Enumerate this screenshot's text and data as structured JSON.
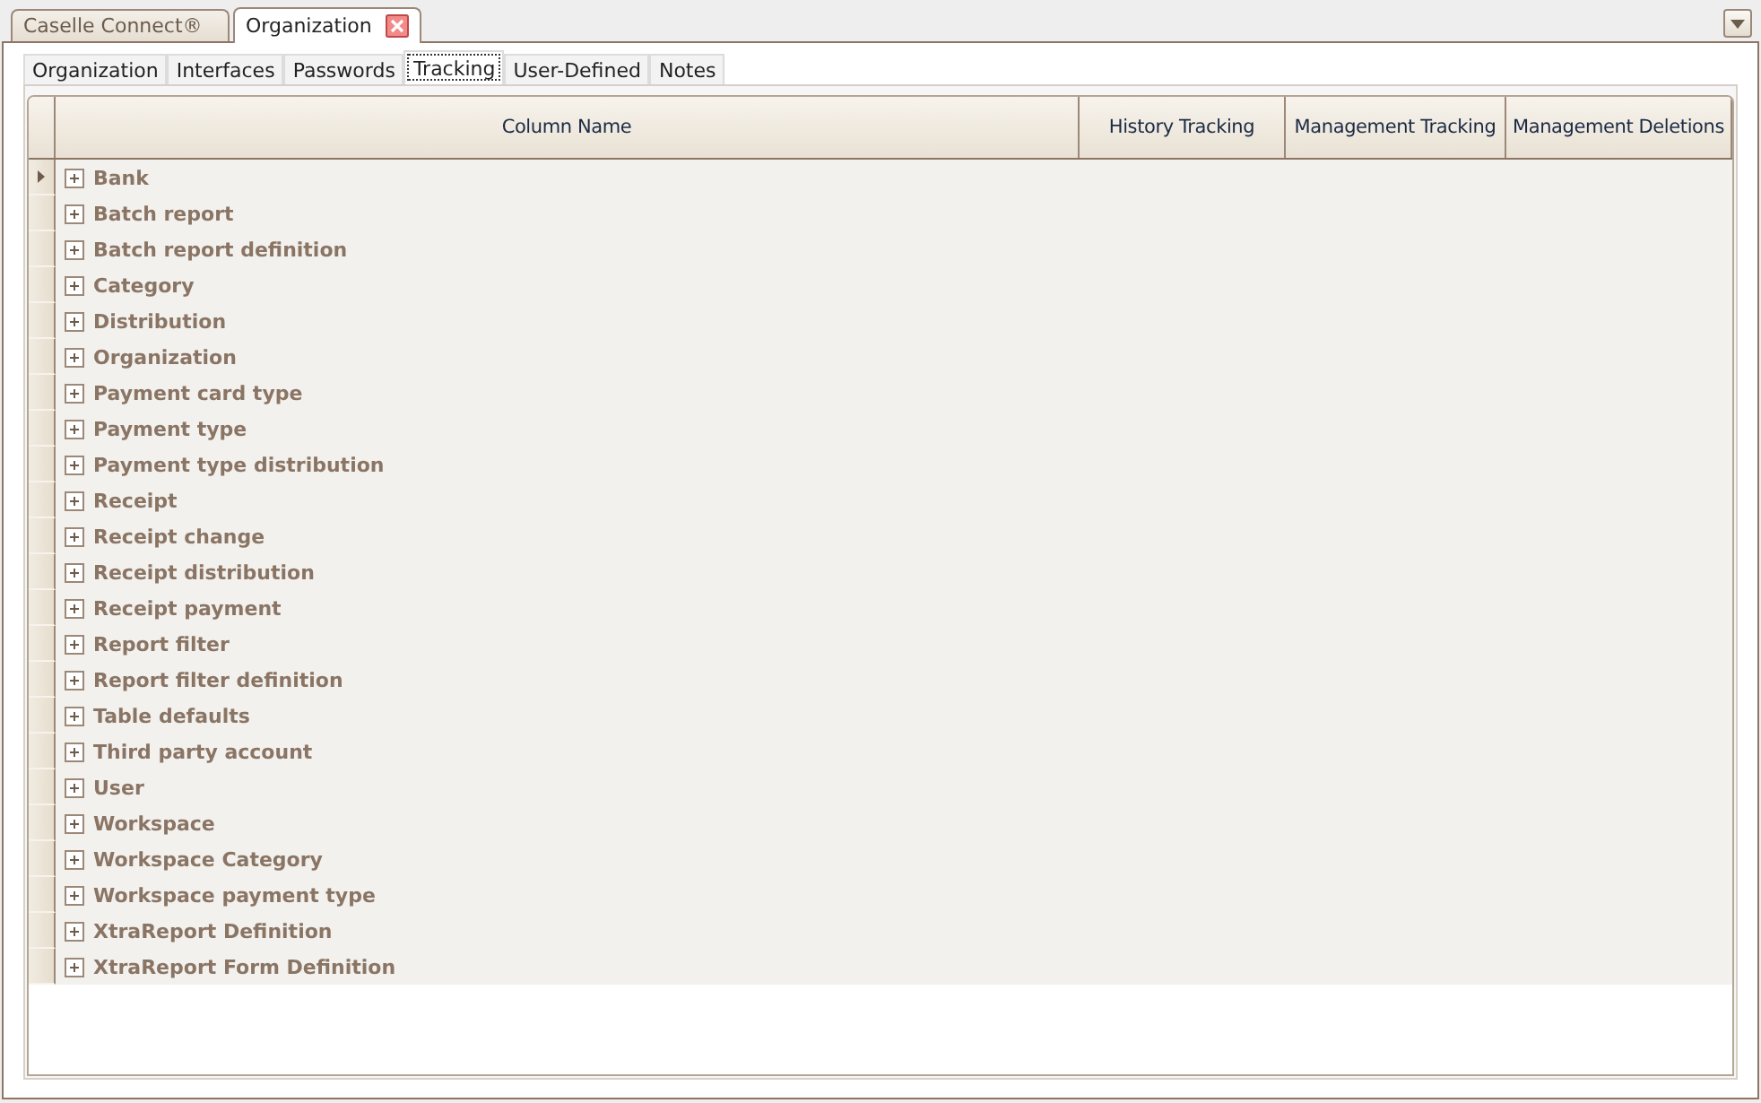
{
  "document_tabs": [
    {
      "label": "Caselle Connect®",
      "selected": false,
      "closable": false
    },
    {
      "label": "Organization",
      "selected": true,
      "closable": true
    }
  ],
  "tabs": [
    {
      "label": "Organization",
      "selected": false
    },
    {
      "label": "Interfaces",
      "selected": false
    },
    {
      "label": "Passwords",
      "selected": false
    },
    {
      "label": "Tracking",
      "selected": true
    },
    {
      "label": "User-Defined",
      "selected": false
    },
    {
      "label": "Notes",
      "selected": false
    }
  ],
  "table": {
    "columns": [
      "Column Name",
      "History Tracking",
      "Management Tracking",
      "Management Deletions"
    ],
    "rows": [
      {
        "name": "Bank",
        "selected": true,
        "expanded": false
      },
      {
        "name": "Batch report",
        "selected": false,
        "expanded": false
      },
      {
        "name": "Batch report definition",
        "selected": false,
        "expanded": false
      },
      {
        "name": "Category",
        "selected": false,
        "expanded": false
      },
      {
        "name": "Distribution",
        "selected": false,
        "expanded": false
      },
      {
        "name": "Organization",
        "selected": false,
        "expanded": false
      },
      {
        "name": "Payment card type",
        "selected": false,
        "expanded": false
      },
      {
        "name": "Payment type",
        "selected": false,
        "expanded": false
      },
      {
        "name": "Payment type distribution",
        "selected": false,
        "expanded": false
      },
      {
        "name": "Receipt",
        "selected": false,
        "expanded": false
      },
      {
        "name": "Receipt change",
        "selected": false,
        "expanded": false
      },
      {
        "name": "Receipt distribution",
        "selected": false,
        "expanded": false
      },
      {
        "name": "Receipt payment",
        "selected": false,
        "expanded": false
      },
      {
        "name": "Report filter",
        "selected": false,
        "expanded": false
      },
      {
        "name": "Report filter definition",
        "selected": false,
        "expanded": false
      },
      {
        "name": "Table defaults",
        "selected": false,
        "expanded": false
      },
      {
        "name": "Third party account",
        "selected": false,
        "expanded": false
      },
      {
        "name": "User",
        "selected": false,
        "expanded": false
      },
      {
        "name": "Workspace",
        "selected": false,
        "expanded": false
      },
      {
        "name": "Workspace Category",
        "selected": false,
        "expanded": false
      },
      {
        "name": "Workspace payment type",
        "selected": false,
        "expanded": false
      },
      {
        "name": "XtraReport Definition",
        "selected": false,
        "expanded": false
      },
      {
        "name": "XtraReport Form Definition",
        "selected": false,
        "expanded": false
      }
    ]
  }
}
